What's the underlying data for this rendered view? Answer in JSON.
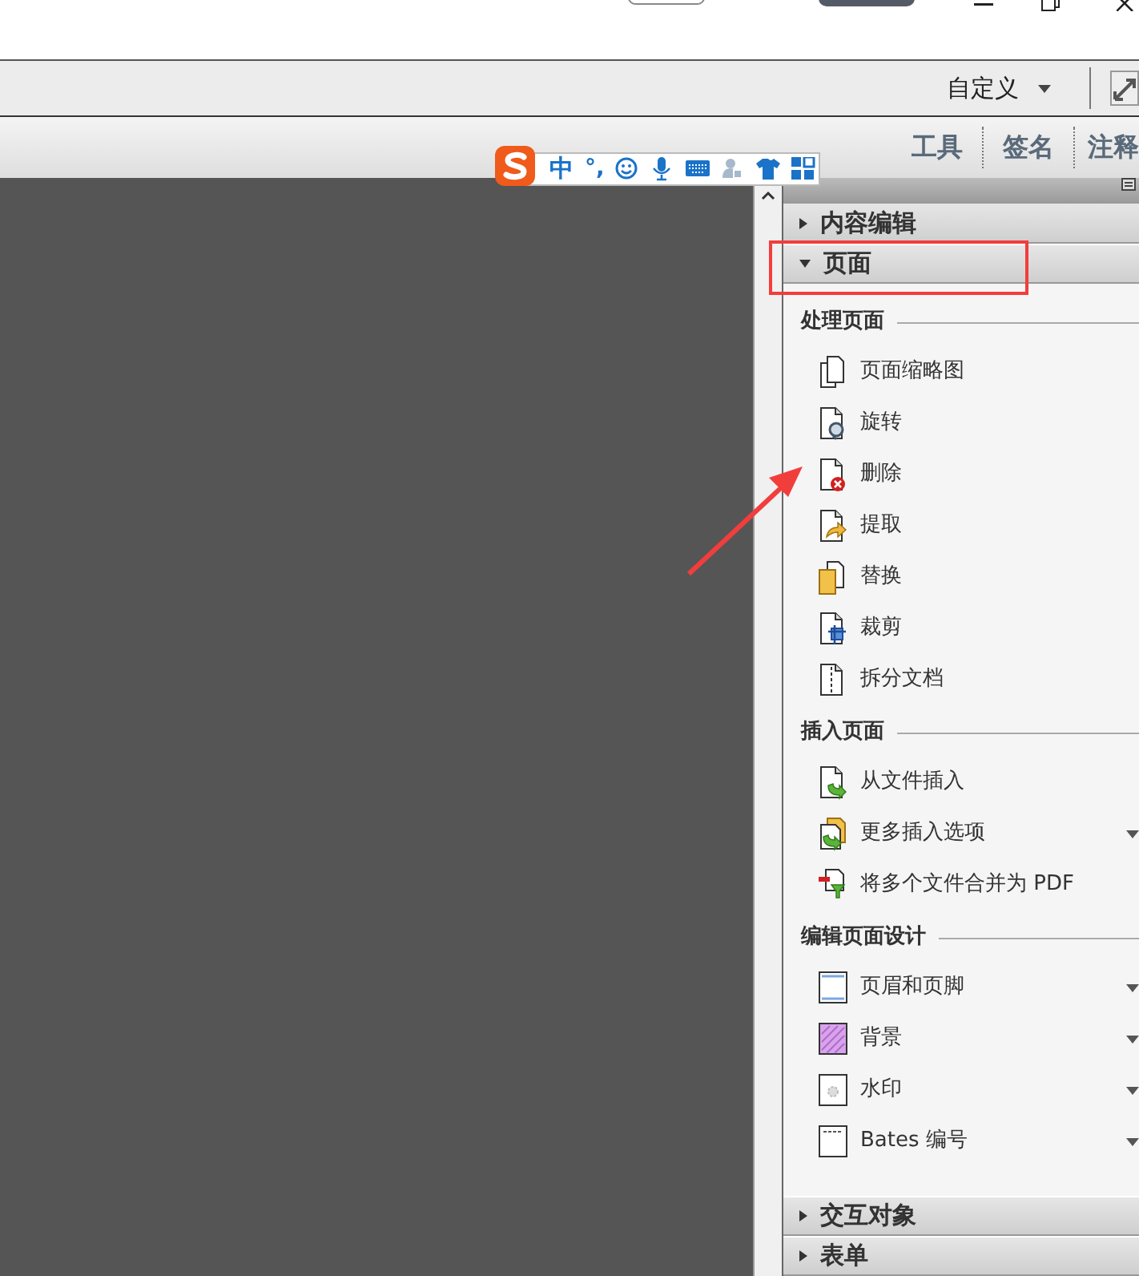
{
  "toolbar": {
    "customize": "自定义"
  },
  "tabs": [
    {
      "label": "工具",
      "selected": false
    },
    {
      "label": "签名",
      "selected": false
    },
    {
      "label": "注释",
      "selected": false
    }
  ],
  "ime_toolbar": {
    "mode": "中",
    "punctuation": "°,"
  },
  "panels": [
    {
      "title": "内容编辑",
      "expanded": false,
      "highlighted": false
    },
    {
      "title": "页面",
      "expanded": true,
      "highlighted": true,
      "groups": [
        {
          "title": "处理页面",
          "items": [
            {
              "label": "页面缩略图",
              "kind": "pages",
              "has_menu": false
            },
            {
              "label": "旋转",
              "kind": "rotate",
              "has_menu": false
            },
            {
              "label": "删除",
              "kind": "delete",
              "has_menu": false
            },
            {
              "label": "提取",
              "kind": "extract",
              "has_menu": false
            },
            {
              "label": "替换",
              "kind": "replace",
              "has_menu": false
            },
            {
              "label": "裁剪",
              "kind": "crop",
              "has_menu": false
            },
            {
              "label": "拆分文档",
              "kind": "split",
              "has_menu": false
            }
          ]
        },
        {
          "title": "插入页面",
          "items": [
            {
              "label": "从文件插入",
              "kind": "insert",
              "has_menu": false
            },
            {
              "label": "更多插入选项",
              "kind": "insert-more",
              "has_menu": true
            },
            {
              "label": "将多个文件合并为 PDF",
              "kind": "combine",
              "has_menu": false
            }
          ]
        },
        {
          "title": "编辑页面设计",
          "items": [
            {
              "label": "页眉和页脚",
              "kind": "header",
              "has_menu": true
            },
            {
              "label": "背景",
              "kind": "background",
              "has_menu": true
            },
            {
              "label": "水印",
              "kind": "watermark",
              "has_menu": true
            },
            {
              "label": "Bates 编号",
              "kind": "bates",
              "has_menu": true
            }
          ]
        }
      ]
    },
    {
      "title": "交互对象",
      "expanded": false,
      "highlighted": false
    },
    {
      "title": "表单",
      "expanded": false,
      "highlighted": false
    }
  ],
  "annotations": [
    {
      "kind": "arrow"
    }
  ]
}
